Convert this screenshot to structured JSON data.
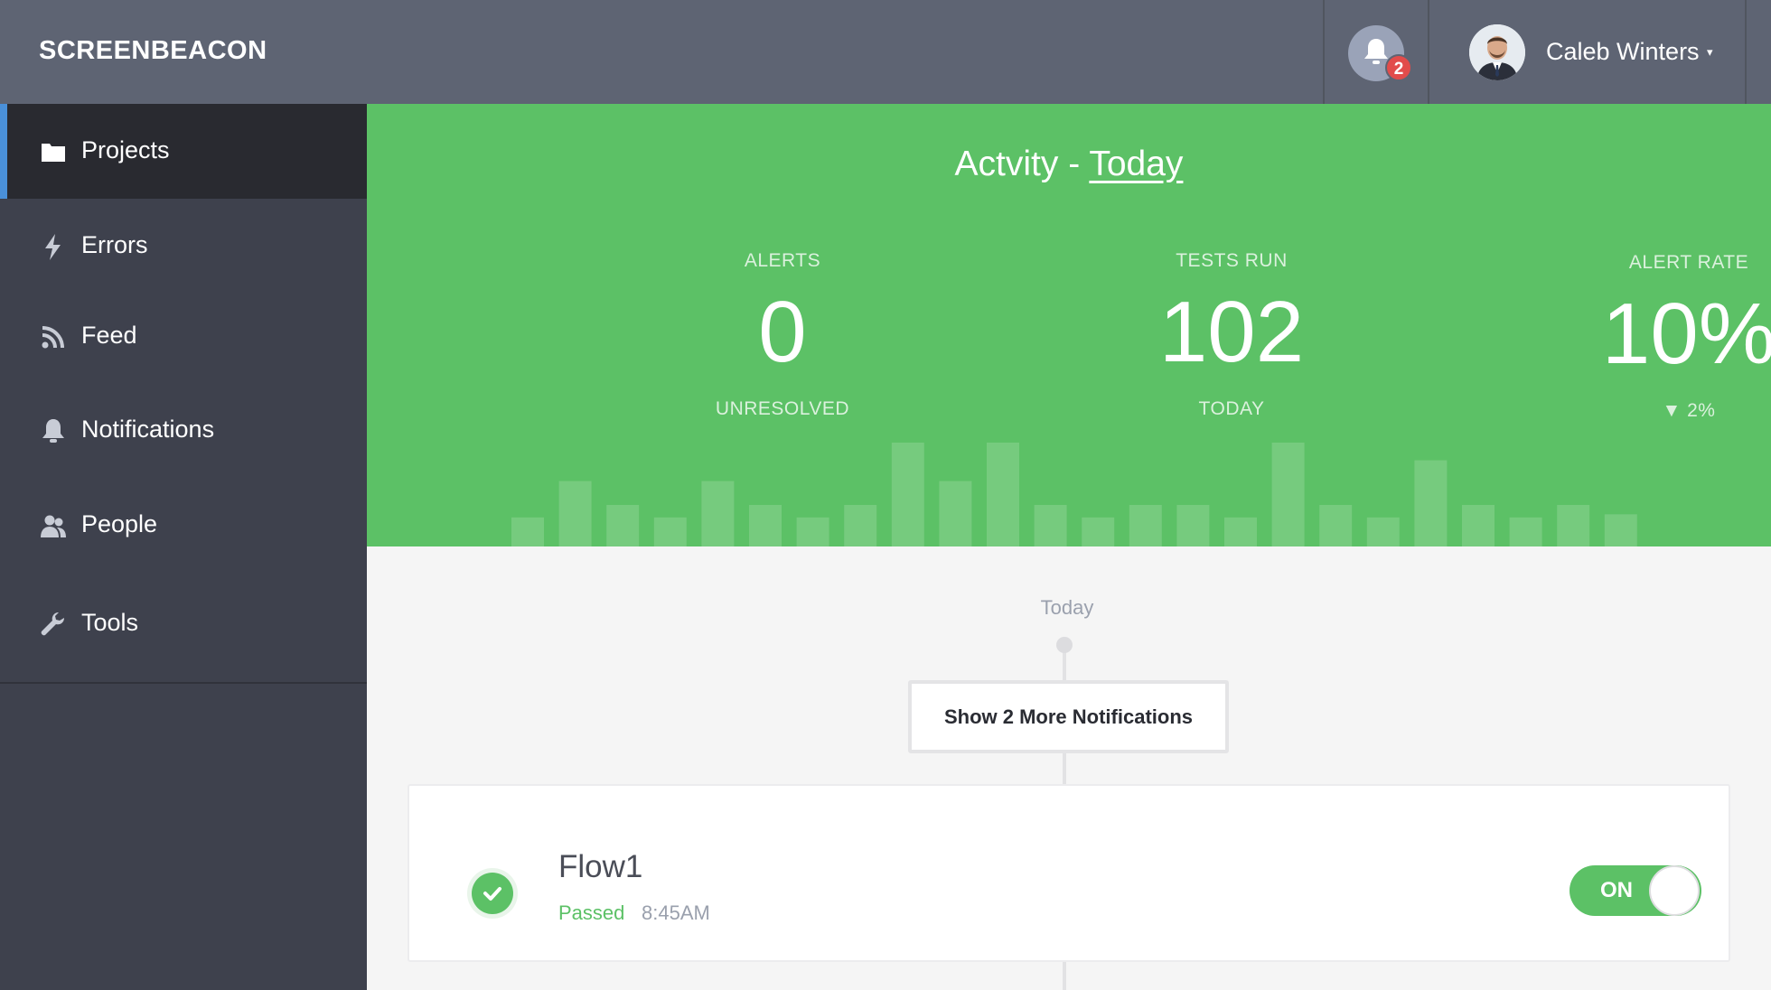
{
  "header": {
    "brand": "SCREENBEACON",
    "notification_count": "2",
    "user_name": "Caleb Winters",
    "user_caret": "▾"
  },
  "sidebar": {
    "items": [
      {
        "label": "Projects",
        "icon": "folder-icon",
        "active": true
      },
      {
        "label": "Errors",
        "icon": "lightning-icon"
      },
      {
        "label": "Feed",
        "icon": "rss-icon"
      },
      {
        "label": "Notifications",
        "icon": "bell-icon"
      },
      {
        "label": "People",
        "icon": "people-icon"
      },
      {
        "label": "Tools",
        "icon": "wrench-icon"
      }
    ]
  },
  "activity": {
    "title_prefix": "Actvity - ",
    "title_link": "Today",
    "stats": [
      {
        "label": "ALERTS",
        "value": "0",
        "sub": "UNRESOLVED"
      },
      {
        "label": "TESTS RUN",
        "value": "102",
        "sub": "TODAY"
      },
      {
        "label": "ALERT RATE",
        "value": "10%",
        "sub": "▼ 2%"
      }
    ],
    "bar_levels": [
      0.28,
      0.63,
      0.4,
      0.28,
      0.63,
      0.4,
      0.28,
      0.4,
      1.0,
      0.63,
      1.0,
      0.4,
      0.28,
      0.4,
      0.4,
      0.28,
      1.0,
      0.4,
      0.28,
      0.83,
      0.4,
      0.28,
      0.4,
      0.31
    ],
    "accent_color": "#5cc166"
  },
  "timeline": {
    "date_label": "Today",
    "more_button": "Show 2 More Notifications"
  },
  "flow": {
    "name": "Flow1",
    "status": "Passed",
    "time": "8:45AM",
    "toggle_label": "ON",
    "status_color": "#5cc166"
  }
}
